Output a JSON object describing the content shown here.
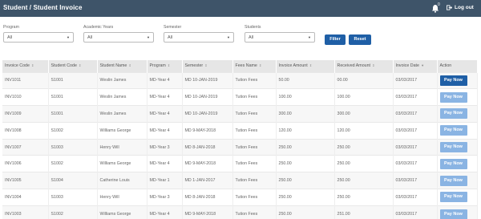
{
  "header": {
    "title": "Student / Student Invoice",
    "notification_count": "0",
    "logout_label": "Log out"
  },
  "filters": {
    "program": {
      "label": "Program",
      "value": "All"
    },
    "academic_years": {
      "label": "Academic Years",
      "value": "All"
    },
    "semester": {
      "label": "Semester",
      "value": "All"
    },
    "students": {
      "label": "Students",
      "value": "All"
    },
    "filter_label": "Filter",
    "reset_label": "Reset"
  },
  "table": {
    "headers": [
      "Invoice Code",
      "Student Code",
      "Student Name",
      "Program",
      "Semester",
      "Fees Name",
      "Invoice Amount",
      "Received Amount",
      "Invoice Date",
      "Action"
    ],
    "rows": [
      [
        "INV1011",
        "S1001",
        "Weslin James",
        "MD-Year 4",
        "MD 10-JAN-2019",
        "Tution Fees",
        "50.00",
        "00.00",
        "03/03/2017",
        "Pay Now"
      ],
      [
        "INV1010",
        "S1001",
        "Weslin James",
        "MD-Year 4",
        "MD 10-JAN-2019",
        "Tution Fees",
        "100.00",
        "100.00",
        "03/03/2017",
        "Pay Now"
      ],
      [
        "INV1009",
        "S1001",
        "Weslin James",
        "MD-Year 4",
        "MD 10-JAN-2019",
        "Tution Fees",
        "300.00",
        "300.00",
        "03/03/2017",
        "Pay Now"
      ],
      [
        "INV1008",
        "S1002",
        "Williams George",
        "MD-Year 4",
        "MD 9-MAY-2018",
        "Tution Fees",
        "120.00",
        "120.00",
        "03/03/2017",
        "Pay Now"
      ],
      [
        "INV1007",
        "S1003",
        "Henry Will",
        "MD-Year 3",
        "MD 8-JAN-2018",
        "Tution Fees",
        "250.00",
        "250.00",
        "03/03/2017",
        "Pay Now"
      ],
      [
        "INV1006",
        "S1002",
        "Williams George",
        "MD-Year 4",
        "MD 9-MAY-2018",
        "Tution Fees",
        "250.00",
        "250.00",
        "03/03/2017",
        "Pay Now"
      ],
      [
        "INV1005",
        "S1004",
        "Catherine Louis",
        "MD-Year 1",
        "MD 1-JAN-2017",
        "Tution Fees",
        "250.00",
        "250.00",
        "03/03/2017",
        "Pay Now"
      ],
      [
        "INV1004",
        "S1003",
        "Henry Will",
        "MD-Year 3",
        "MD 8-JAN-2018",
        "Tution Fees",
        "250.00",
        "250.00",
        "03/03/2017",
        "Pay Now"
      ],
      [
        "INV1003",
        "S1002",
        "Williams George",
        "MD-Year 4",
        "MD 9-MAY-2018",
        "Tution Fees",
        "250.00",
        "251.00",
        "03/03/2017",
        "Pay Now"
      ]
    ],
    "active_rows": [
      0
    ]
  },
  "colors": {
    "header_bg": "#3e5469",
    "primary": "#1f5fa6",
    "pay_inactive": "#8ab4e3"
  }
}
